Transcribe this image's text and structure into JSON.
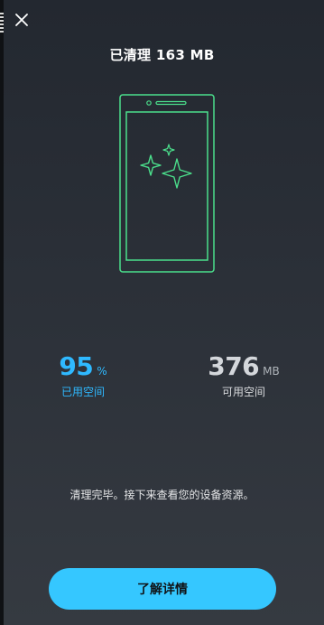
{
  "header": {
    "title": "已清理 163 MB"
  },
  "colors": {
    "background_top": "#232830",
    "background_bottom": "#353a41",
    "accent_green": "#4be08c",
    "accent_blue": "#2fb9ff",
    "button": "#35c7ff"
  },
  "icons": {
    "close": "close-icon",
    "illustration": "phone-sparkle-illustration"
  },
  "stats": {
    "used": {
      "value": "95",
      "unit": "%",
      "label": "已用空间"
    },
    "free": {
      "value": "376",
      "unit": "MB",
      "label": "可用空间"
    }
  },
  "message": "清理完毕。接下来查看您的设备资源。",
  "button": {
    "label": "了解详情"
  }
}
